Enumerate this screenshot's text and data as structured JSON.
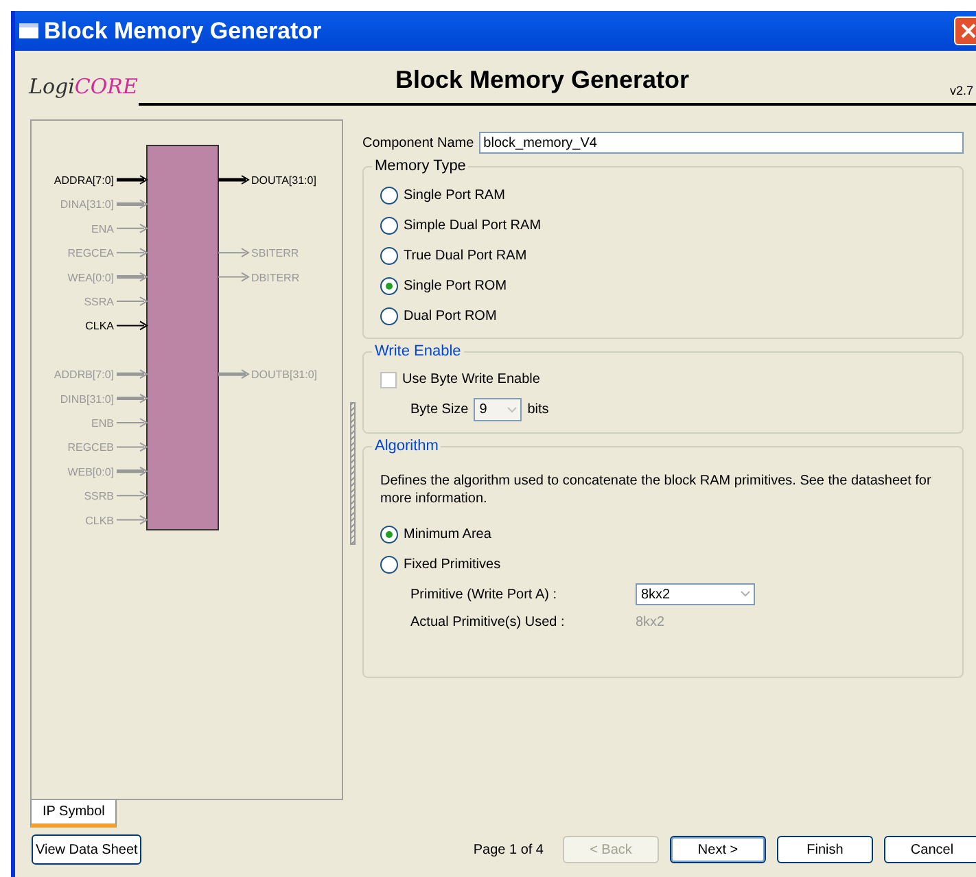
{
  "window": {
    "title": "Block Memory Generator"
  },
  "header": {
    "logo_prefix": "Logi",
    "logo_suffix": "CORE",
    "title": "Block Memory Generator",
    "version": "v2.7"
  },
  "symbol": {
    "left_pins": [
      {
        "kind": "pin",
        "label": "ADDRA[7:0]",
        "active": true,
        "bus": true
      },
      {
        "kind": "pin",
        "label": "DINA[31:0]",
        "active": false,
        "bus": true
      },
      {
        "kind": "pin",
        "label": "ENA",
        "active": false,
        "bus": false
      },
      {
        "kind": "pin",
        "label": "REGCEA",
        "active": false,
        "bus": false
      },
      {
        "kind": "pin",
        "label": "WEA[0:0]",
        "active": false,
        "bus": true
      },
      {
        "kind": "pin",
        "label": "SSRA",
        "active": false,
        "bus": false
      },
      {
        "kind": "pin",
        "label": "CLKA",
        "active": true,
        "bus": false
      },
      {
        "kind": "gap"
      },
      {
        "kind": "pin",
        "label": "ADDRB[7:0]",
        "active": false,
        "bus": true
      },
      {
        "kind": "pin",
        "label": "DINB[31:0]",
        "active": false,
        "bus": true
      },
      {
        "kind": "pin",
        "label": "ENB",
        "active": false,
        "bus": false
      },
      {
        "kind": "pin",
        "label": "REGCEB",
        "active": false,
        "bus": false
      },
      {
        "kind": "pin",
        "label": "WEB[0:0]",
        "active": false,
        "bus": true
      },
      {
        "kind": "pin",
        "label": "SSRB",
        "active": false,
        "bus": false
      },
      {
        "kind": "pin",
        "label": "CLKB",
        "active": false,
        "bus": false
      }
    ],
    "right_pins": [
      {
        "kind": "pin",
        "label": "DOUTA[31:0]",
        "active": true,
        "bus": true
      },
      {
        "kind": "gap"
      },
      {
        "kind": "gap"
      },
      {
        "kind": "pin",
        "label": "SBITERR",
        "active": false,
        "bus": false
      },
      {
        "kind": "pin",
        "label": "DBITERR",
        "active": false,
        "bus": false
      },
      {
        "kind": "gap"
      },
      {
        "kind": "gap"
      },
      {
        "kind": "gap"
      },
      {
        "kind": "pin",
        "label": "DOUTB[31:0]",
        "active": false,
        "bus": true
      }
    ]
  },
  "tabs": [
    {
      "label": "IP Symbol",
      "selected": true
    }
  ],
  "component_name": {
    "label": "Component Name",
    "value": "block_memory_V4"
  },
  "memory_type": {
    "title": "Memory Type",
    "options": [
      {
        "label": "Single Port RAM",
        "selected": false
      },
      {
        "label": "Simple Dual Port RAM",
        "selected": false
      },
      {
        "label": "True Dual Port RAM",
        "selected": false
      },
      {
        "label": "Single Port ROM",
        "selected": true
      },
      {
        "label": "Dual Port ROM",
        "selected": false
      }
    ]
  },
  "write_enable": {
    "title": "Write Enable",
    "checkbox": {
      "label": "Use Byte Write Enable",
      "checked": false
    },
    "byte_size": {
      "label": "Byte Size",
      "value": "9",
      "unit": "bits",
      "disabled": true
    }
  },
  "algorithm": {
    "title": "Algorithm",
    "description": "Defines the algorithm used to concatenate the block RAM primitives.  See the datasheet for more information.",
    "options": [
      {
        "label": "Minimum Area",
        "selected": true
      },
      {
        "label": "Fixed Primitives",
        "selected": false
      }
    ],
    "primitive": {
      "label": "Primitive (Write Port A) :",
      "value": "8kx2",
      "disabled": false
    },
    "actual": {
      "label": "Actual Primitive(s) Used :",
      "value": "8kx2"
    }
  },
  "footer": {
    "datasheet_button": "View Data Sheet",
    "page": "Page 1 of 4",
    "buttons": [
      {
        "label": "< Back",
        "disabled": true,
        "default": false
      },
      {
        "label": "Next >",
        "disabled": false,
        "default": true
      },
      {
        "label": "Finish",
        "disabled": false,
        "default": false
      },
      {
        "label": "Cancel",
        "disabled": false,
        "default": false
      }
    ]
  }
}
